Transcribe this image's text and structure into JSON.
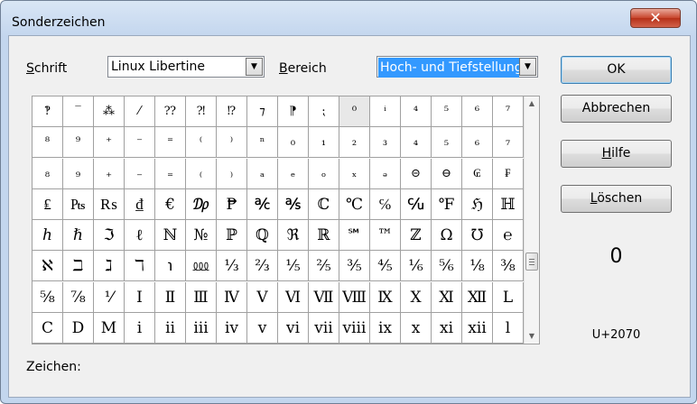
{
  "window": {
    "title": "Sonderzeichen",
    "close_glyph": "✕"
  },
  "font": {
    "label": "Schrift",
    "value": "Linux Libertine"
  },
  "subset": {
    "label": "Bereich",
    "value": "Hoch- und Tiefstellungen"
  },
  "buttons": {
    "ok": "OK",
    "cancel": "Abbrechen",
    "help": "Hilfe",
    "delete": "Löschen"
  },
  "preview": {
    "char": "0",
    "code": "U+2070"
  },
  "status": {
    "chars_label": "Zeichen:"
  },
  "grid": {
    "columns": 16,
    "rows": [
      [
        "‽",
        "‾",
        "⁂",
        "⁄",
        "⁇",
        "⁈",
        "⁉",
        "⁊",
        "⁋",
        "⁏",
        "⁰",
        "ⁱ",
        "⁴",
        "⁵",
        "⁶",
        "⁷"
      ],
      [
        "⁸",
        "⁹",
        "⁺",
        "⁻",
        "⁼",
        "⁽",
        "⁾",
        "ⁿ",
        "₀",
        "₁",
        "₂",
        "₃",
        "₄",
        "₅",
        "₆",
        "₇"
      ],
      [
        "₈",
        "₉",
        "₊",
        "₋",
        "₌",
        "₍",
        "₎",
        "ₐ",
        "ₑ",
        "ₒ",
        "ₓ",
        "ₔ",
        "⊝",
        "⊖",
        "₢",
        "₣"
      ],
      [
        "₤",
        "₧",
        "₨",
        "₫",
        "€",
        "₯",
        "₱",
        "℀",
        "℁",
        "ℂ",
        "℃",
        "℅",
        "℆",
        "℉",
        "ℌ",
        "ℍ"
      ],
      [
        "ℎ",
        "ℏ",
        "ℑ",
        "ℓ",
        "ℕ",
        "№",
        "ℙ",
        "ℚ",
        "ℜ",
        "ℝ",
        "℠",
        "™",
        "ℤ",
        "Ω",
        "℧",
        "℮"
      ],
      [
        "ℵ",
        "ℶ",
        "ℷ",
        "ℸ",
        "℩",
        "⅏",
        "⅓",
        "⅔",
        "⅕",
        "⅖",
        "⅗",
        "⅘",
        "⅙",
        "⅚",
        "⅛",
        "⅜"
      ],
      [
        "⅝",
        "⅞",
        "⅟",
        "Ⅰ",
        "Ⅱ",
        "Ⅲ",
        "Ⅳ",
        "Ⅴ",
        "Ⅵ",
        "Ⅶ",
        "Ⅷ",
        "Ⅸ",
        "Ⅹ",
        "Ⅺ",
        "Ⅻ",
        "Ⅼ"
      ],
      [
        "Ⅽ",
        "Ⅾ",
        "Ⅿ",
        "ⅰ",
        "ⅱ",
        "ⅲ",
        "ⅳ",
        "ⅴ",
        "ⅵ",
        "ⅶ",
        "ⅷ",
        "ⅸ",
        "ⅹ",
        "ⅺ",
        "ⅻ",
        "ⅼ"
      ]
    ],
    "selected": {
      "row": 0,
      "col": 10
    }
  },
  "colors": {
    "selection_bg": "#3399ff",
    "dialog_bg": "#f0f0f0",
    "frame": "#c3d6ee",
    "close_red": "#c8452c"
  }
}
